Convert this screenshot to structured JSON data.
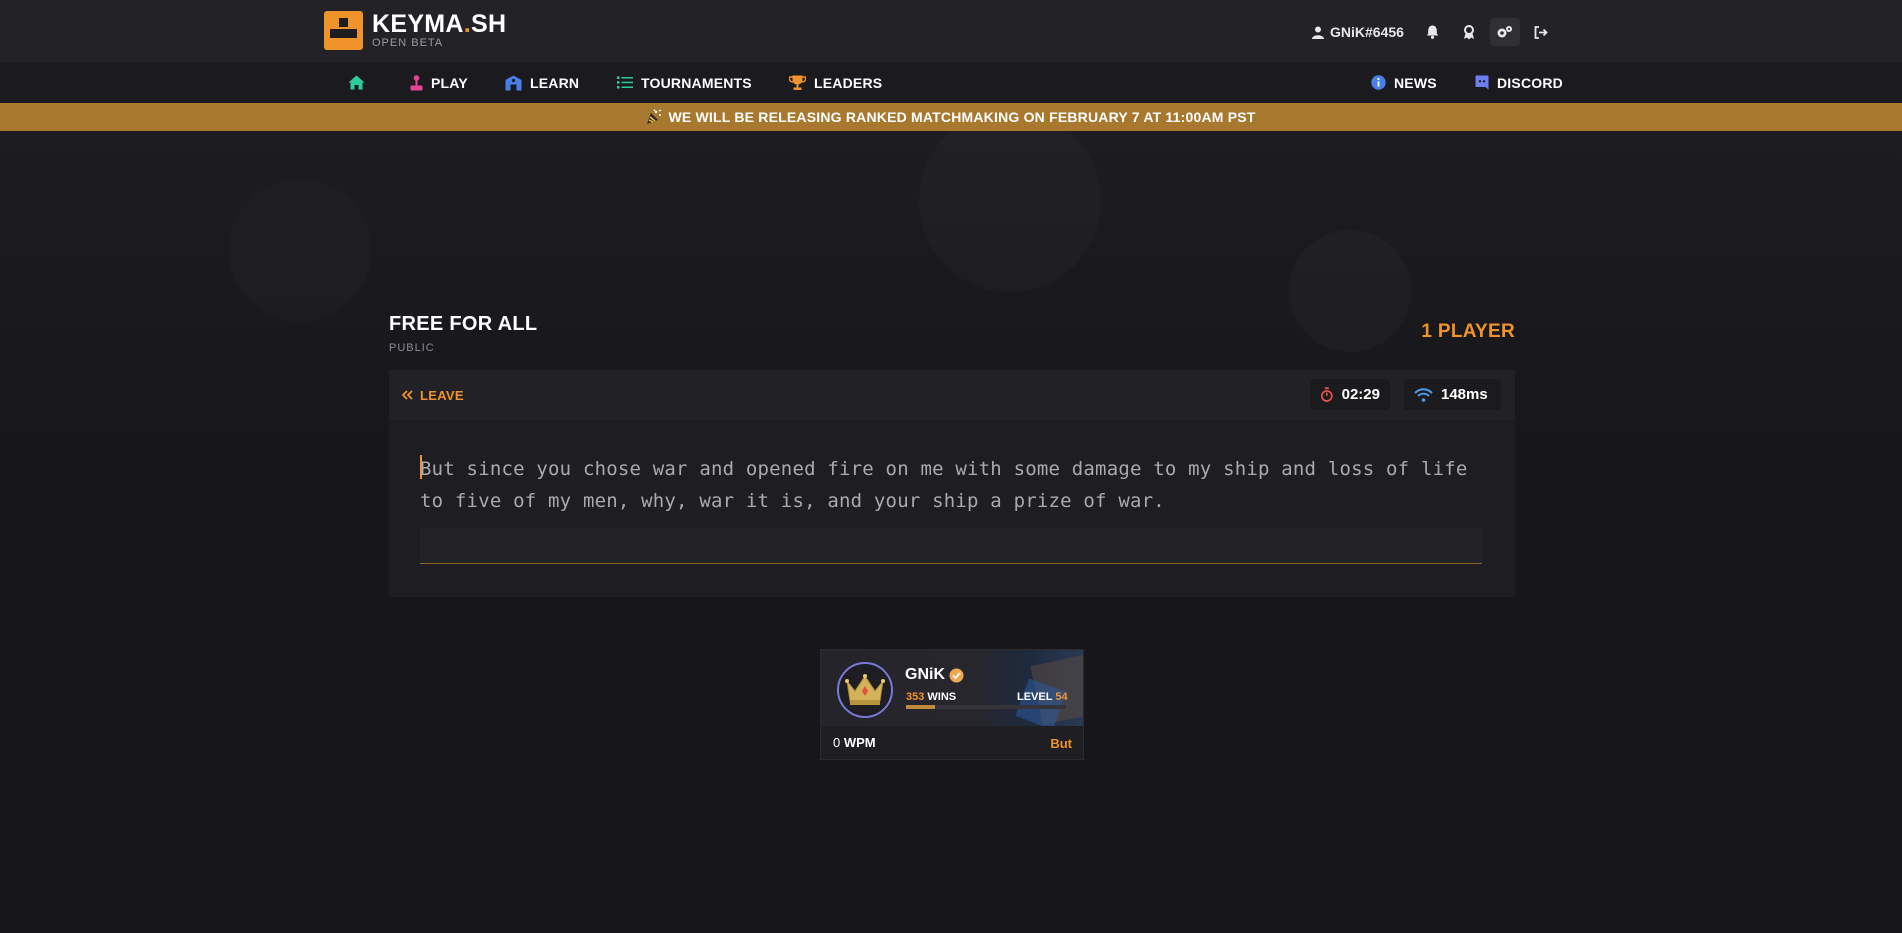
{
  "header": {
    "logo_title_main": "KEYMA",
    "logo_title_dot": ".",
    "logo_title_end": "SH",
    "logo_subtitle": "OPEN BETA",
    "username": "GNiK#6456"
  },
  "nav": {
    "left": [
      {
        "label": "",
        "icon": "home-icon",
        "color": "#2ecc9a"
      },
      {
        "label": "PLAY",
        "icon": "joystick-icon",
        "color": "#e84393"
      },
      {
        "label": "LEARN",
        "icon": "school-icon",
        "color": "#4a7fe8"
      },
      {
        "label": "TOURNAMENTS",
        "icon": "list-icon",
        "color": "#2ecc9a"
      },
      {
        "label": "LEADERS",
        "icon": "trophy-icon",
        "color": "#f0932b"
      }
    ],
    "right": [
      {
        "label": "NEWS",
        "icon": "info-icon",
        "color": "#4a7fe8"
      },
      {
        "label": "DISCORD",
        "icon": "discord-icon",
        "color": "#6c7ff2"
      }
    ]
  },
  "banner": {
    "text": "WE WILL BE RELEASING RANKED MATCHMAKING ON FEBRUARY 7 AT 11:00AM PST",
    "icon": "party-popper-icon"
  },
  "game": {
    "mode_title": "FREE FOR ALL",
    "mode_sub": "PUBLIC",
    "player_count": "1 PLAYER",
    "leave_label": "LEAVE",
    "timer": "02:29",
    "ping": "148ms",
    "text_line1": "But since you chose war and opened fire on me with some damage to my ship and loss of life",
    "text_line2": "to five of my men, why, war it is, and your ship a prize of war."
  },
  "player": {
    "name": "GNiK",
    "wins_value": "353",
    "wins_label": "WINS",
    "level_label": "LEVEL",
    "level_value": "54",
    "xp_progress": 0.18,
    "wpm_value": "0",
    "wpm_label": "WPM",
    "current_word": "But"
  },
  "colors": {
    "accent": "#f0932b",
    "banner": "#a8782f"
  }
}
